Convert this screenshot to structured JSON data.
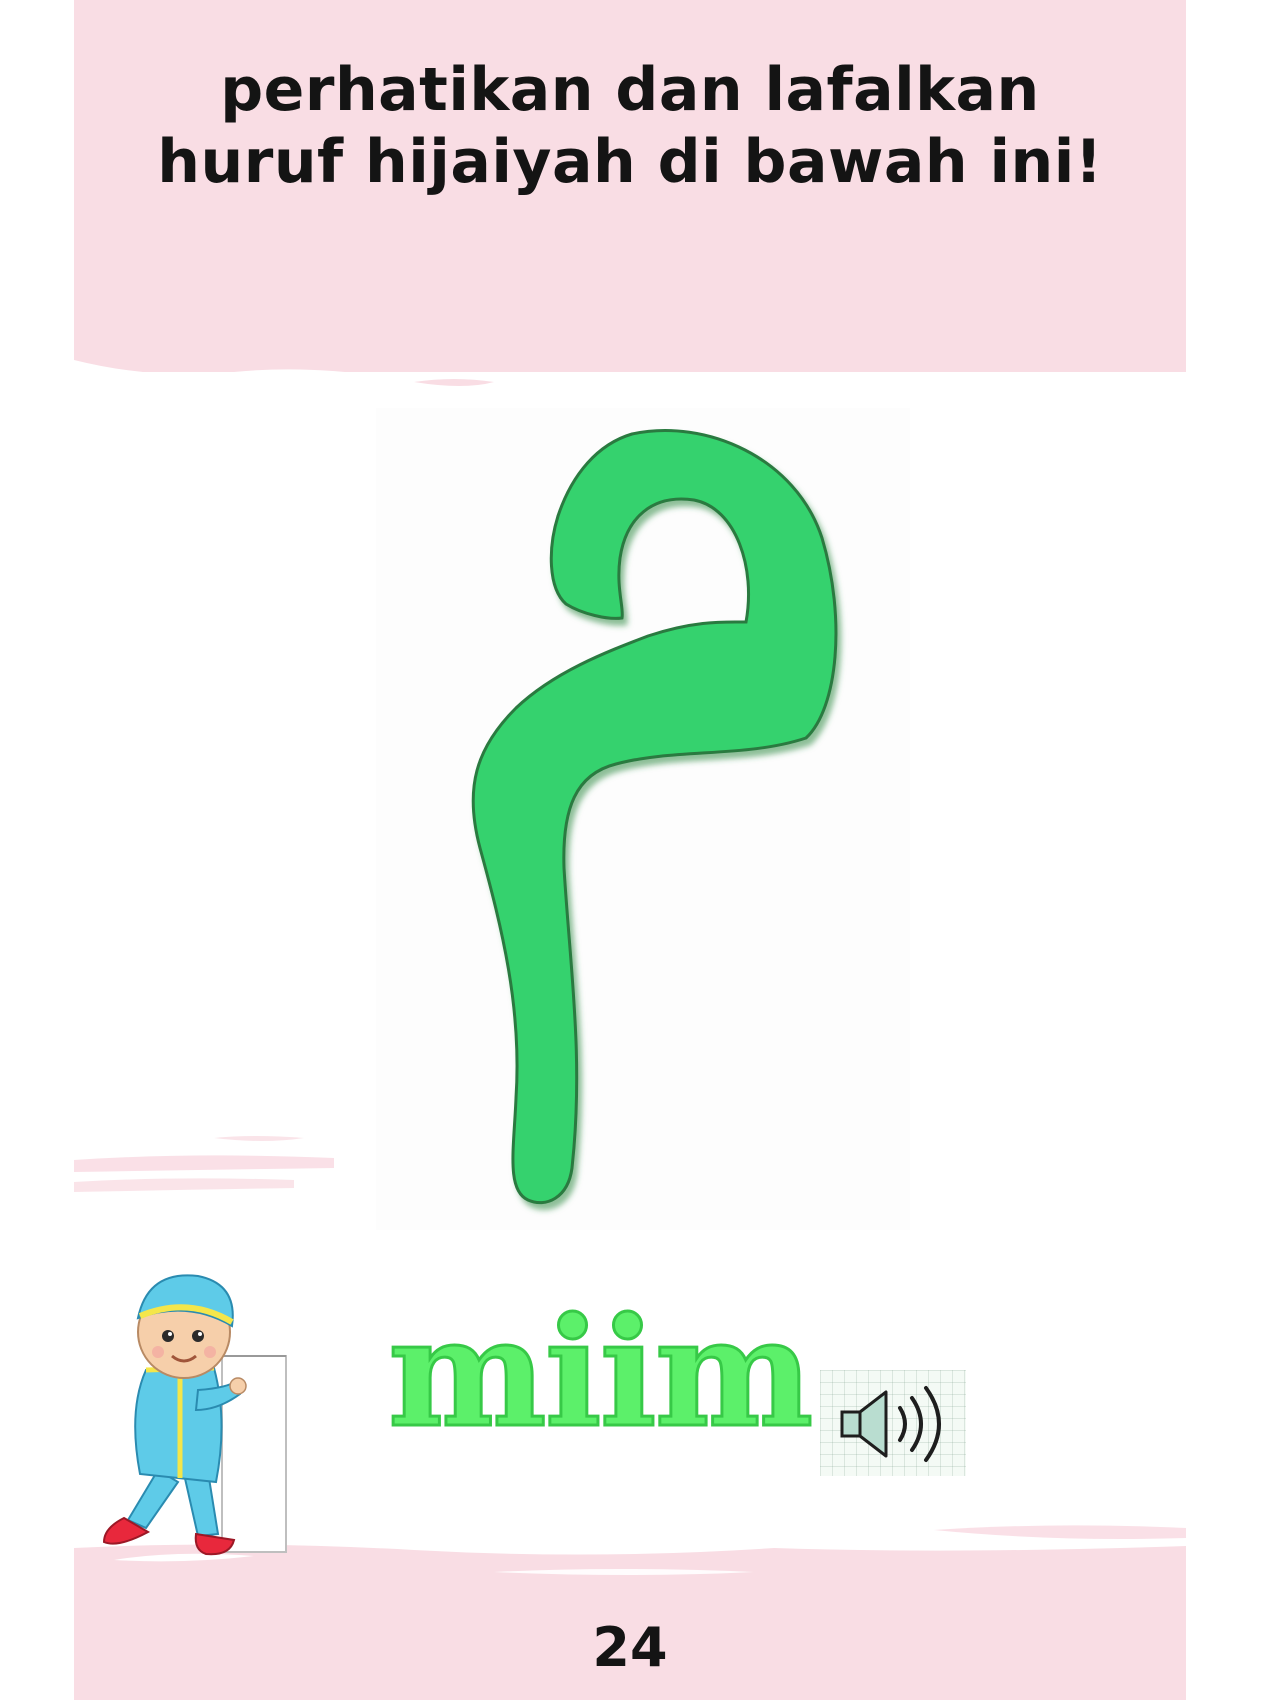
{
  "header": {
    "line1": "perhatikan dan lafalkan",
    "line2": "huruf hijaiyah di bawah ini!"
  },
  "letter": {
    "glyph": "م",
    "name": "miim",
    "color": "#35d26e"
  },
  "audio": {
    "icon": "speaker-icon"
  },
  "footer": {
    "page_number": "24"
  },
  "colors": {
    "pink_background": "#f9dde4",
    "letter_green": "#35d26e",
    "word_green": "#5cf06a"
  }
}
